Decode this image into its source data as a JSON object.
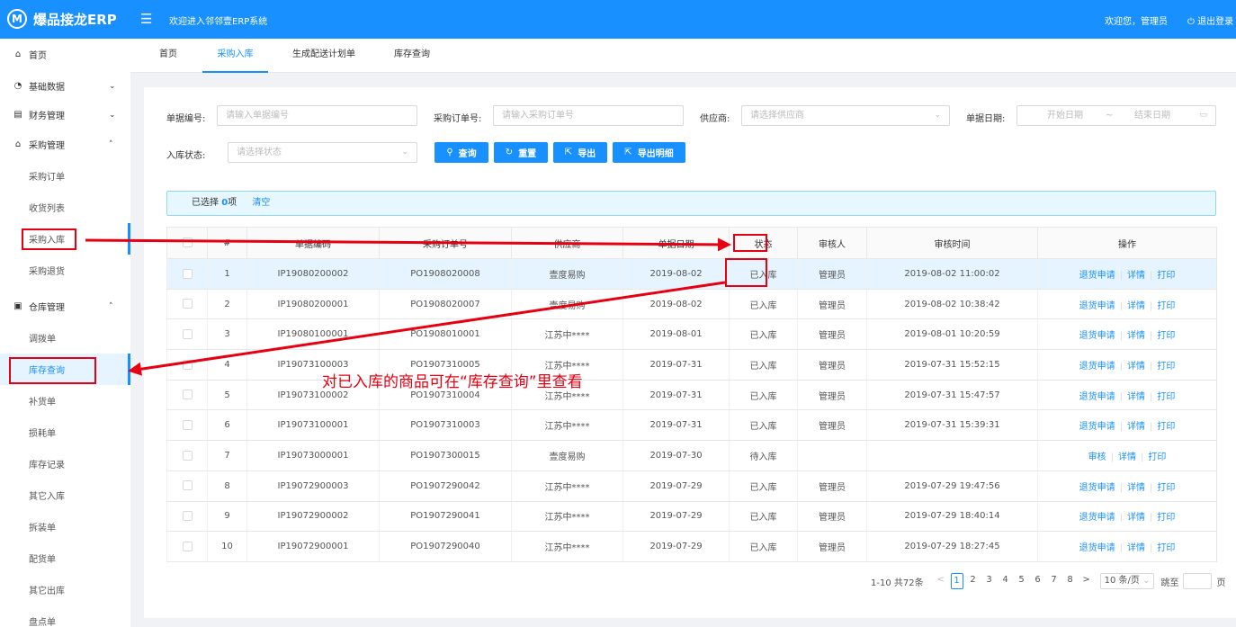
{
  "app": {
    "logo_letter": "M",
    "brand": "爆品接龙ERP",
    "welcome": "欢迎进入邻邻壹ERP系统",
    "user_greeting": "欢迎您，管理员",
    "logout": "退出登录"
  },
  "sidebar": {
    "home": "首页",
    "basic_data": "基础数据",
    "finance": "财务管理",
    "purchase": "采购管理",
    "purchase_order": "采购订单",
    "receipt_list": "收货列表",
    "purchase_in": "采购入库",
    "purchase_return": "采购退货",
    "warehouse": "仓库管理",
    "transfer": "调拨单",
    "stock_query": "库存查询",
    "replenish": "补货单",
    "loss": "损耗单",
    "stock_record": "库存记录",
    "other_in": "其它入库",
    "disassemble": "拆装单",
    "distribution": "配货单",
    "other_out": "其它出库",
    "inventory": "盘点单"
  },
  "tabs": [
    "首页",
    "采购入库",
    "生成配送计划单",
    "库存查询"
  ],
  "filters": {
    "doc_no_label": "单据编号:",
    "doc_no_placeholder": "请输入单据编号",
    "po_no_label": "采购订单号:",
    "po_no_placeholder": "请输入采购订单号",
    "supplier_label": "供应商:",
    "supplier_placeholder": "请选择供应商",
    "date_label": "单据日期:",
    "date_start": "开始日期",
    "date_sep": "~",
    "date_end": "结束日期",
    "status_label": "入库状态:",
    "status_placeholder": "请选择状态"
  },
  "buttons": {
    "query": "查询",
    "reset": "重置",
    "export": "导出",
    "export_detail": "导出明细"
  },
  "selection": {
    "prefix": "已选择 ",
    "count": "0",
    "suffix": "项",
    "clear": "清空"
  },
  "table": {
    "headers": [
      "#",
      "单据编码",
      "采购订单号",
      "供应商",
      "单据日期",
      "状态",
      "审核人",
      "审核时间",
      "操作"
    ],
    "ops": {
      "return": "退货申请",
      "detail": "详情",
      "print": "打印",
      "audit": "审核"
    },
    "rows": [
      {
        "no": "1",
        "code": "IP19080200002",
        "po": "PO1908020008",
        "supplier": "壹度易购",
        "date": "2019-08-02",
        "status": "已入库",
        "auditor": "管理员",
        "audit_time": "2019-08-02 11:00:02"
      },
      {
        "no": "2",
        "code": "IP19080200001",
        "po": "PO1908020007",
        "supplier": "壹度易购",
        "date": "2019-08-02",
        "status": "已入库",
        "auditor": "管理员",
        "audit_time": "2019-08-02 10:38:42"
      },
      {
        "no": "3",
        "code": "IP19080100001",
        "po": "PO1908010001",
        "supplier": "江苏中****",
        "date": "2019-08-01",
        "status": "已入库",
        "auditor": "管理员",
        "audit_time": "2019-08-01 10:20:59"
      },
      {
        "no": "4",
        "code": "IP19073100003",
        "po": "PO1907310005",
        "supplier": "江苏中****",
        "date": "2019-07-31",
        "status": "已入库",
        "auditor": "管理员",
        "audit_time": "2019-07-31 15:52:15"
      },
      {
        "no": "5",
        "code": "IP19073100002",
        "po": "PO1907310004",
        "supplier": "江苏中****",
        "date": "2019-07-31",
        "status": "已入库",
        "auditor": "管理员",
        "audit_time": "2019-07-31 15:47:57"
      },
      {
        "no": "6",
        "code": "IP19073100001",
        "po": "PO1907310003",
        "supplier": "江苏中****",
        "date": "2019-07-31",
        "status": "已入库",
        "auditor": "管理员",
        "audit_time": "2019-07-31 15:39:31"
      },
      {
        "no": "7",
        "code": "IP19073000001",
        "po": "PO1907300015",
        "supplier": "壹度易购",
        "date": "2019-07-30",
        "status": "待入库",
        "auditor": "",
        "audit_time": ""
      },
      {
        "no": "8",
        "code": "IP19072900003",
        "po": "PO1907290042",
        "supplier": "江苏中****",
        "date": "2019-07-29",
        "status": "已入库",
        "auditor": "管理员",
        "audit_time": "2019-07-29 19:47:56"
      },
      {
        "no": "9",
        "code": "IP19072900002",
        "po": "PO1907290041",
        "supplier": "江苏中****",
        "date": "2019-07-29",
        "status": "已入库",
        "auditor": "管理员",
        "audit_time": "2019-07-29 18:40:14"
      },
      {
        "no": "10",
        "code": "IP19072900001",
        "po": "PO1907290040",
        "supplier": "江苏中****",
        "date": "2019-07-29",
        "status": "已入库",
        "auditor": "管理员",
        "audit_time": "2019-07-29 18:27:45"
      }
    ]
  },
  "pagination": {
    "summary": "1-10 共72条",
    "prev": "<",
    "pages": [
      "1",
      "2",
      "3",
      "4",
      "5",
      "6",
      "7",
      "8"
    ],
    "current": "1",
    "next": ">",
    "page_size": "10 条/页",
    "jump_label": "跳至",
    "page_label": "页"
  },
  "annotation": {
    "text": "对已入库的商品可在“库存查询”里查看",
    "color": "#e60012"
  },
  "colors": {
    "primary": "#1890ff",
    "annotation": "#e60012"
  },
  "icons": [
    "home-icon",
    "pie-chart-icon",
    "calculator-icon",
    "shopping-bag-icon",
    "box-icon",
    "search-icon",
    "reload-icon",
    "export-icon",
    "calendar-icon",
    "chevron-down-icon",
    "menu-fold-icon",
    "logout-icon"
  ]
}
